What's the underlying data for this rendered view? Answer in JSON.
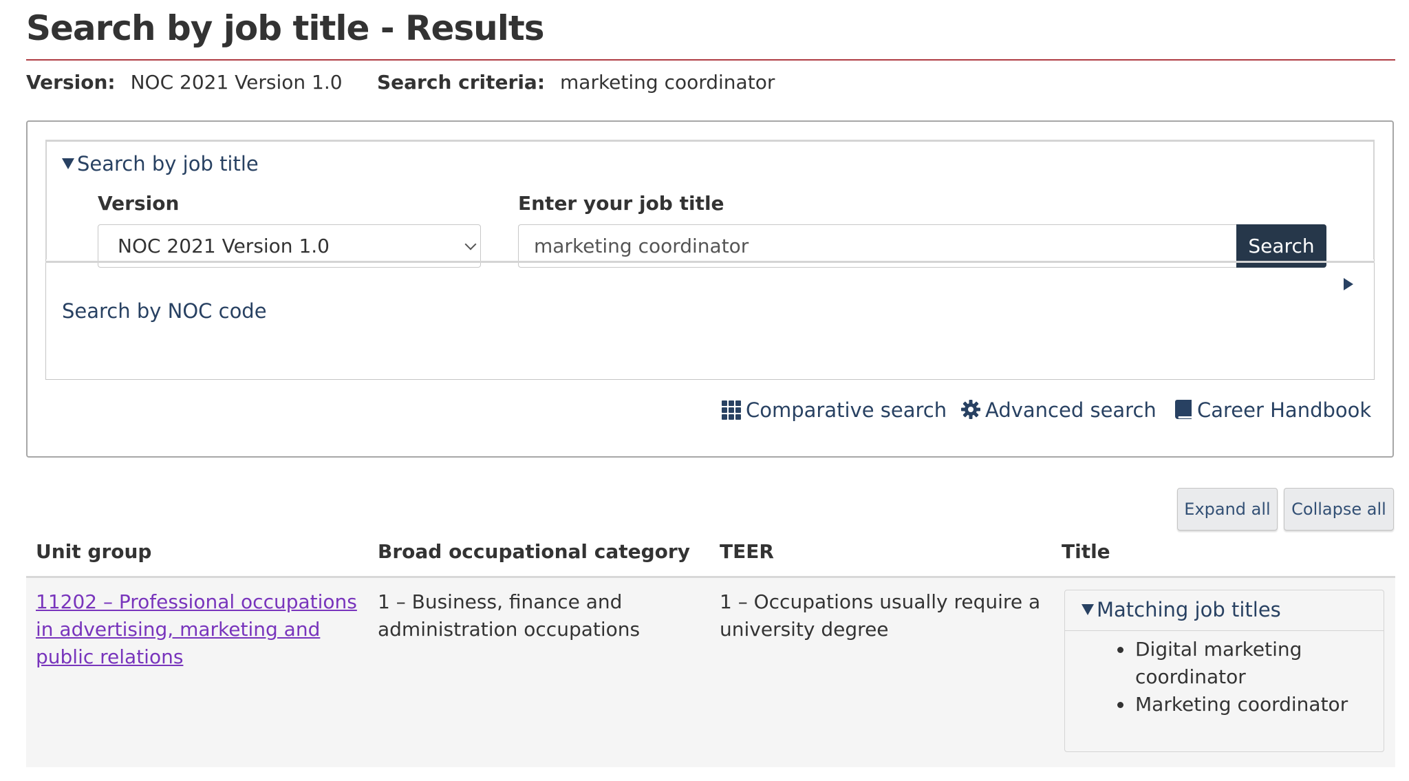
{
  "header": {
    "title": "Search by job title - Results",
    "version_label": "Version:",
    "version_value": "NOC 2021 Version 1.0",
    "criteria_label": "Search criteria:",
    "criteria_value": "marketing coordinator"
  },
  "search_panel": {
    "job_title_summary": "Search by job title",
    "version_label": "Version",
    "version_selected": "NOC 2021 Version 1.0",
    "job_title_label": "Enter your job title",
    "job_title_value": "marketing coordinator",
    "search_button": "Search",
    "noc_summary": "Search by NOC code"
  },
  "tools": {
    "comparative": "Comparative search",
    "advanced": "Advanced search",
    "handbook": "Career Handbook"
  },
  "actions": {
    "expand_all": "Expand all",
    "collapse_all": "Collapse all"
  },
  "table": {
    "headers": [
      "Unit group",
      "Broad occupational category",
      "TEER",
      "Title"
    ],
    "rows": [
      {
        "unit_group_link": "11202 – Professional occupations in advertising, marketing and public relations",
        "broad_category": "1 – Business, finance and administration occupations",
        "teer": "1 – Occupations usually require a university degree",
        "title_summary": "Matching job titles",
        "titles": [
          "Digital marketing coordinator",
          "Marketing coordinator"
        ]
      }
    ]
  },
  "colors": {
    "title_rule": "#af3c43",
    "link": "#284162",
    "visited_link": "#7834bc",
    "search_button": "#26374a"
  }
}
